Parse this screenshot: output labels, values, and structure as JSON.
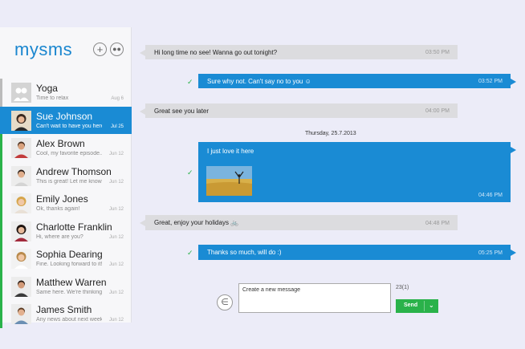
{
  "app": {
    "brand": "mysms"
  },
  "header": {
    "add_icon": "plus-icon",
    "group_icon": "group-icon"
  },
  "contacts": [
    {
      "name": "Yoga",
      "preview": "Time to relax",
      "date": "Aug 6"
    },
    {
      "name": "Sue Johnson",
      "preview": "Can't wait to have you here...",
      "date": "Jul 25"
    },
    {
      "name": "Alex Brown",
      "preview": "Cool, my favorite episode...",
      "date": "Jun 12"
    },
    {
      "name": "Andrew Thomson",
      "preview": "This is great! Let me know...",
      "date": "Jun 12"
    },
    {
      "name": "Emily Jones",
      "preview": "Ok, thanks again!",
      "date": "Jun 12"
    },
    {
      "name": "Charlotte Franklin",
      "preview": "Hi, where are you?",
      "date": "Jun 12"
    },
    {
      "name": "Sophia Dearing",
      "preview": "Fine. Looking forward to it!",
      "date": "Jun 12"
    },
    {
      "name": "Matthew Warren",
      "preview": "Same here. We're thinking...",
      "date": "Jun 12"
    },
    {
      "name": "James Smith",
      "preview": "Any news about next week?",
      "date": "Jun 12"
    }
  ],
  "conversation": {
    "messages": [
      {
        "direction": "in",
        "text": "Hi long time no see! Wanna go out tonight?",
        "time": "03:50 PM"
      },
      {
        "direction": "out",
        "text": "Sure why not. Can't say no to you ☺",
        "time": "03:52 PM"
      },
      {
        "direction": "in",
        "text": "Great see you later",
        "time": "04:00 PM"
      },
      {
        "direction": "out",
        "text": "I just love it here",
        "time": "04:46 PM"
      },
      {
        "direction": "in",
        "text": "Great, enjoy your holidays 🚲",
        "time": "04:48 PM"
      },
      {
        "direction": "out",
        "text": "Thanks so much, will do :)",
        "time": "05:25 PM"
      }
    ],
    "date_separator": "Thursday, 25.7.2013",
    "check_mark": "✓"
  },
  "compose": {
    "placeholder": "Create a new message",
    "char_count": "23(1)",
    "send_label": "Send",
    "attach_icon": "paperclip-icon"
  },
  "colors": {
    "accent": "#1a8bd4",
    "send": "#2ab24a",
    "incoming": "#dcdcdf"
  }
}
